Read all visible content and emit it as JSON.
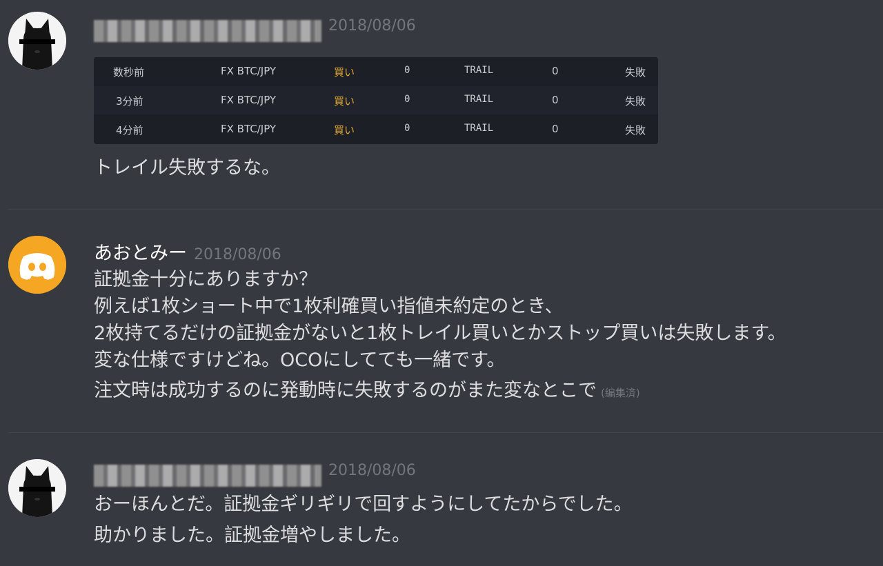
{
  "messages": [
    {
      "username": "",
      "timestamp": "2018/08/06",
      "embed": {
        "rows": [
          [
            "数秒前",
            "FX BTC/JPY",
            "買い",
            "0",
            "TRAIL",
            "0",
            "失敗"
          ],
          [
            "3分前",
            "FX BTC/JPY",
            "買い",
            "0",
            "TRAIL",
            "0",
            "失敗"
          ],
          [
            "4分前",
            "FX BTC/JPY",
            "買い",
            "0",
            "TRAIL",
            "0",
            "失敗"
          ]
        ]
      },
      "lines": [
        "トレイル失敗するな。"
      ]
    },
    {
      "username": "あおとみー",
      "timestamp": "2018/08/06",
      "lines": [
        "証拠金十分にありますか？",
        "例えば1枚ショート中で1枚利確買い指値未約定のとき、",
        "2枚持てるだけの証拠金がないと1枚トレイル買いとかストップ買いは失敗します。",
        "変な仕様ですけどね。OCOにしてても一緒です。",
        "注文時は成功するのに発動時に失敗するのがまた変なとこで"
      ],
      "edited": "(編集済)"
    },
    {
      "username": "",
      "timestamp": "2018/08/06",
      "lines": [
        "おーほんとだ。証拠金ギリギリで回すようにしてたからでした。",
        "助かりました。証拠金増やしました。"
      ]
    }
  ],
  "colors": {
    "background": "#36393f",
    "text": "#dcddde",
    "timestamp": "#72767d",
    "embed_bg": "#1c1f26",
    "buy": "#e0a630",
    "discord_avatar": "#f5a623"
  },
  "icons": {
    "avatar1": "black-cat-avatar",
    "avatar2": "discord-logo-avatar",
    "avatar3": "black-cat-avatar"
  }
}
